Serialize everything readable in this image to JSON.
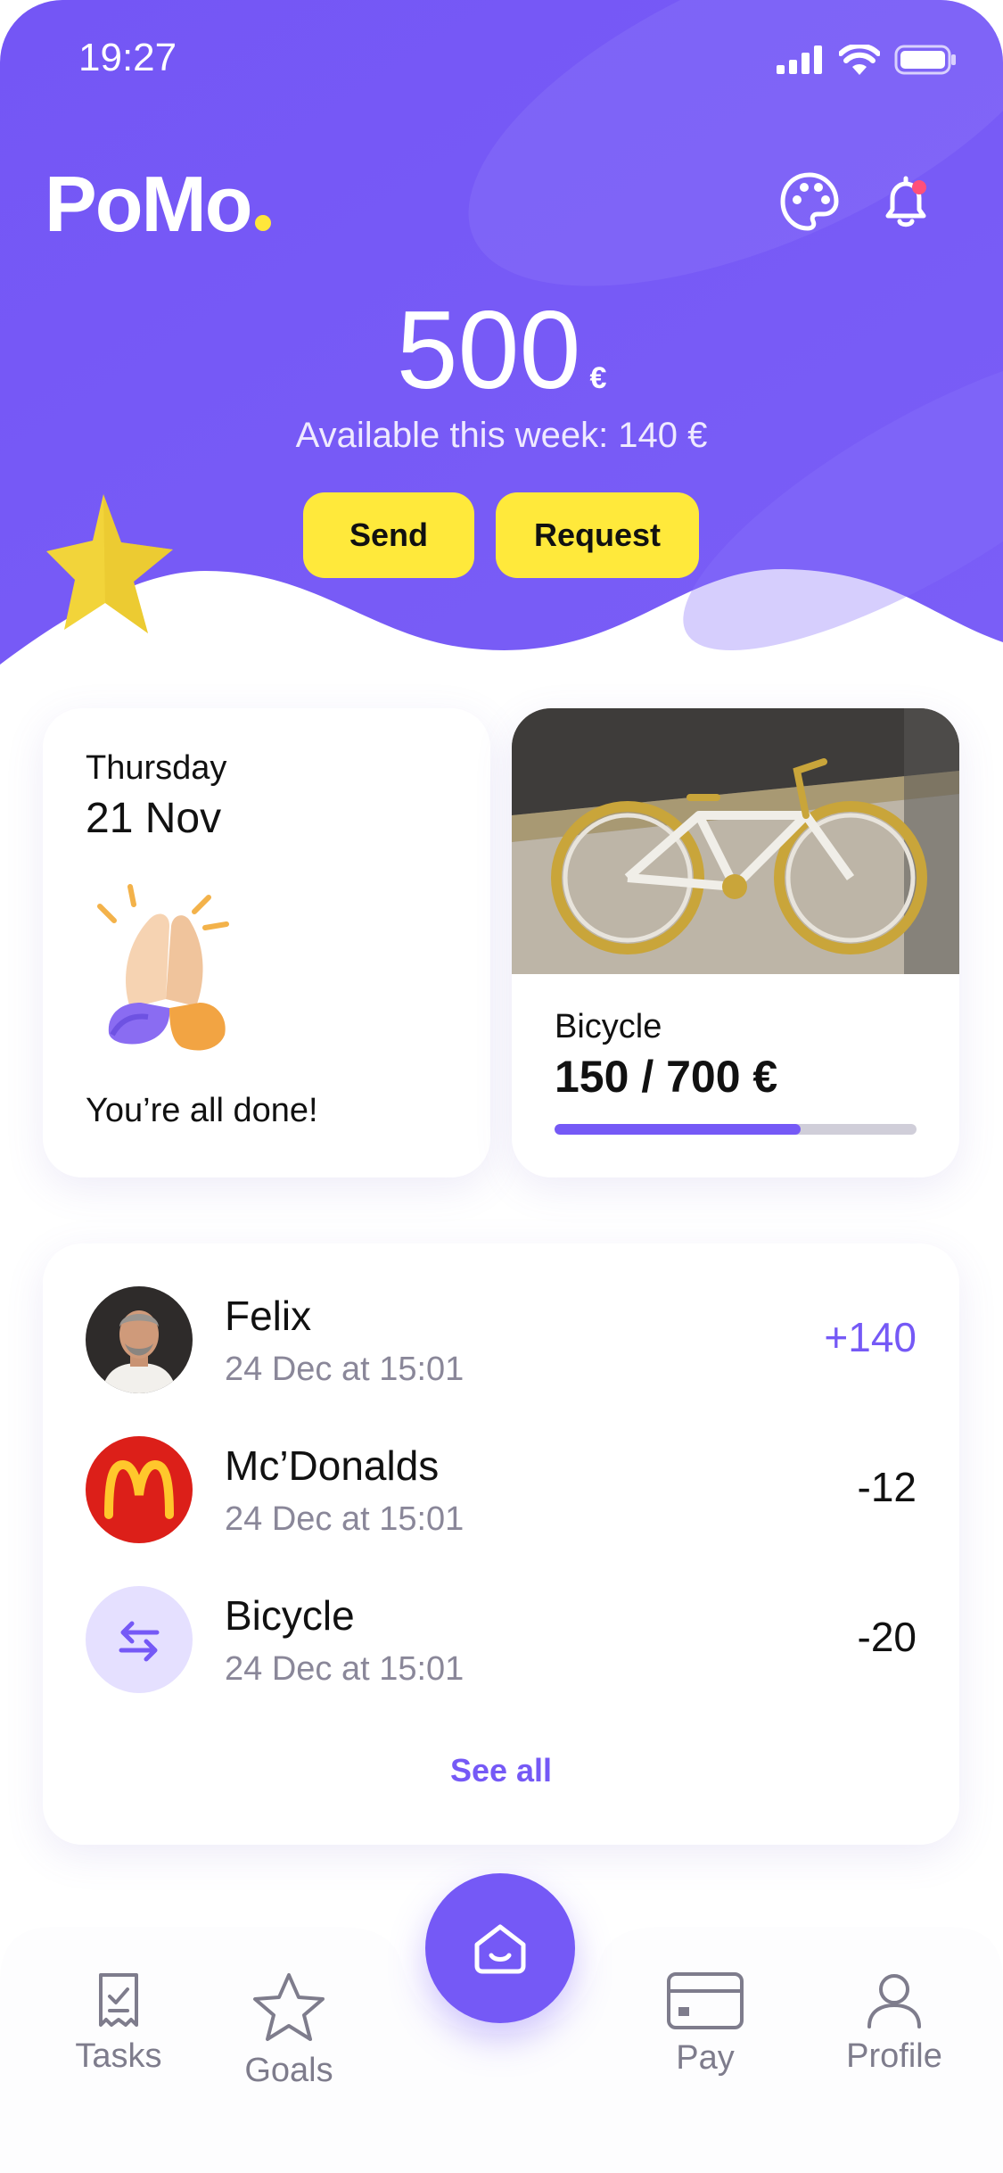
{
  "status_bar": {
    "time": "19:27"
  },
  "header": {
    "logo": "PoMo",
    "balance": "500",
    "currency": "€",
    "available": "Available this week: 140 €"
  },
  "actions": {
    "send": "Send",
    "request": "Request"
  },
  "day_card": {
    "day": "Thursday",
    "date": "21 Nov",
    "status": "You’re all done!"
  },
  "goal_card": {
    "name": "Bicycle",
    "amount": "150 / 700 €",
    "progress": 0.68
  },
  "transactions": [
    {
      "name": "Felix",
      "date": "24 Dec at 15:01",
      "amount": "+140",
      "avatar": "person-avatar"
    },
    {
      "name": "Mc’Donalds",
      "date": "24 Dec at 15:01",
      "amount": "-12",
      "avatar": "mcdonalds-logo"
    },
    {
      "name": "Bicycle",
      "date": "24 Dec at 15:01",
      "amount": "-20",
      "avatar": "transfer-icon"
    }
  ],
  "see_all": "See all",
  "nav": {
    "tasks": "Tasks",
    "goals": "Goals",
    "pay": "Pay",
    "profile": "Profile"
  },
  "colors": {
    "accent": "#7559f6",
    "yellow": "#ffe93b",
    "text": "#111111",
    "muted": "#8a8799"
  }
}
